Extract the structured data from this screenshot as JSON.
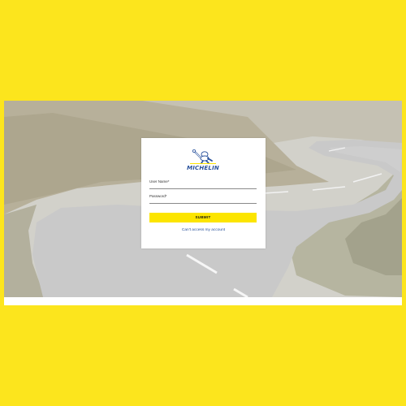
{
  "brand": {
    "logo_text": "MICHELIN",
    "accent_color": "#FCE51D",
    "brand_blue": "#27509B"
  },
  "login": {
    "username_label": "User Name*",
    "password_label": "Password*",
    "submit_label": "SUBMIT",
    "help_link": "Can't access my account"
  }
}
